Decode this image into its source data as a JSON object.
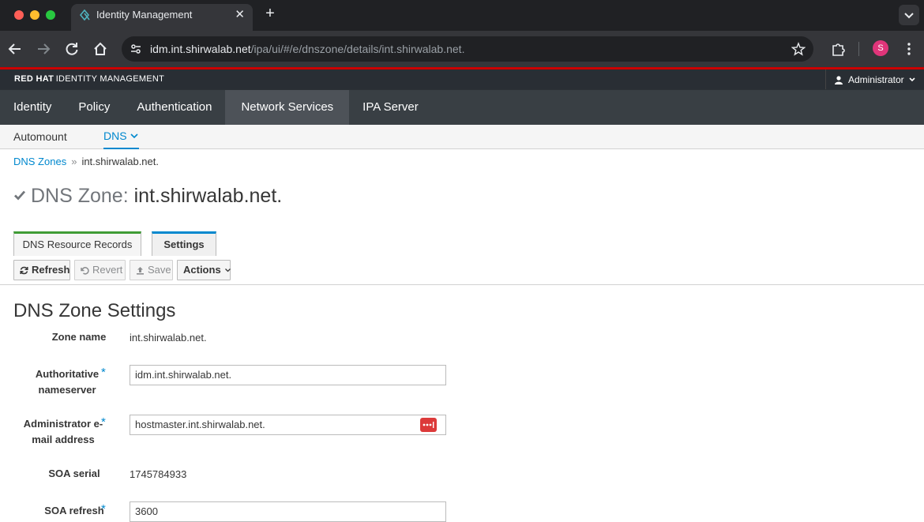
{
  "browser": {
    "tab_title": "Identity Management",
    "tab_close": "✕",
    "new_tab": "+",
    "url_host": "idm.int.shirwalab.net",
    "url_path": "/ipa/ui/#/e/dnszone/details/int.shirwalab.net.",
    "profile_initial": "S"
  },
  "header": {
    "brand_bold": "RED HAT",
    "brand_rest": "IDENTITY MANAGEMENT",
    "user": "Administrator"
  },
  "main_nav": [
    "Identity",
    "Policy",
    "Authentication",
    "Network Services",
    "IPA Server"
  ],
  "main_nav_active": "Network Services",
  "sub_nav": {
    "automount": "Automount",
    "dns": "DNS"
  },
  "breadcrumb": {
    "parent": "DNS Zones",
    "sep": "»",
    "current": "int.shirwalab.net."
  },
  "page": {
    "title_prefix": "DNS Zone:",
    "title_name": "int.shirwalab.net."
  },
  "facet_tabs": {
    "records": "DNS Resource Records",
    "settings": "Settings"
  },
  "actions": {
    "refresh": "Refresh",
    "revert": "Revert",
    "save": "Save",
    "actions": "Actions"
  },
  "section": {
    "title": "DNS Zone Settings"
  },
  "fields": {
    "zone_name_label": "Zone name",
    "zone_name_value": "int.shirwalab.net.",
    "auth_ns_label_1": "Authoritative",
    "auth_ns_label_2": "nameserver",
    "auth_ns_value": "idm.int.shirwalab.net.",
    "admin_email_label_1": "Administrator e-",
    "admin_email_label_2": "mail address",
    "admin_email_value": "hostmaster.int.shirwalab.net.",
    "soa_serial_label": "SOA serial",
    "soa_serial_value": "1745784933",
    "soa_refresh_label": "SOA refresh",
    "soa_refresh_value": "3600",
    "required_mark": "*"
  },
  "colors": {
    "accent": "#0088ce",
    "brand_red": "#cc0000",
    "nav_bg": "#393f44",
    "nav_active_bg": "#4d5258"
  }
}
